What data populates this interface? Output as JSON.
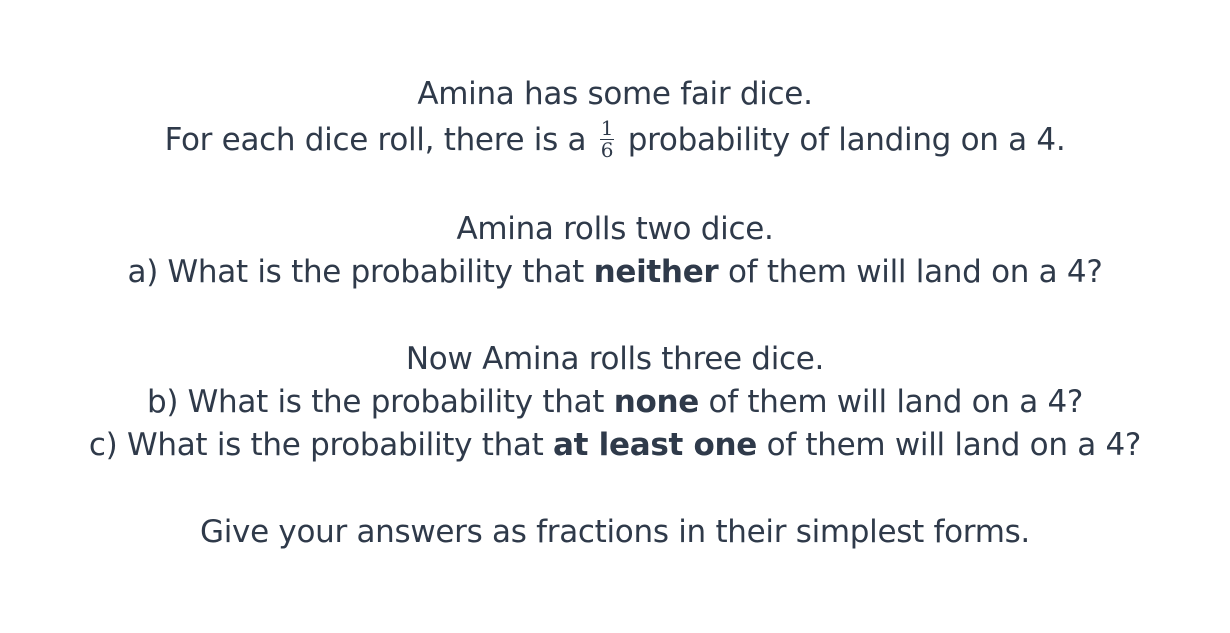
{
  "intro": {
    "line1": "Amina has some fair dice.",
    "line2_before": "For each dice roll, there is a",
    "fraction": {
      "numerator": "1",
      "denominator": "6"
    },
    "line2_after": "probability of landing on a 4."
  },
  "part_a": {
    "setup": "Amina rolls two dice.",
    "q_before": "a) What is the probability that",
    "q_bold": "neither",
    "q_after": "of them will land on a 4?"
  },
  "part_bc": {
    "setup": "Now Amina rolls three dice.",
    "b_before": "b) What is the probability that",
    "b_bold": "none",
    "b_after": "of them will land on a 4?",
    "c_before": "c) What is the probability that",
    "c_bold": "at least one",
    "c_after": "of them will land on a 4?"
  },
  "instruction": "Give your answers as fractions in their simplest forms."
}
